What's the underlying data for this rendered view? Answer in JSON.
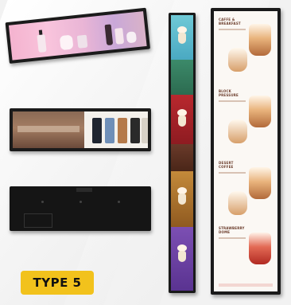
{
  "badge": {
    "label": "TYPE 5"
  },
  "menu": {
    "items": [
      {
        "title": "CAFFE & BREAKFAST"
      },
      {
        "title": "BLOCK PRESSURE"
      },
      {
        "title": "DESERT COFFEE"
      },
      {
        "title": "STRAWBERRY DOME"
      }
    ]
  },
  "colors": {
    "badge_bg": "#f2c21c",
    "frame": "#1a1a1a",
    "page_bg": "#f2f2f2"
  },
  "icons": {
    "cosmetics": "cosmetic-bottles-icon",
    "fashion": "clothing-rack-icon",
    "dessert": "ice-cream-icon"
  }
}
